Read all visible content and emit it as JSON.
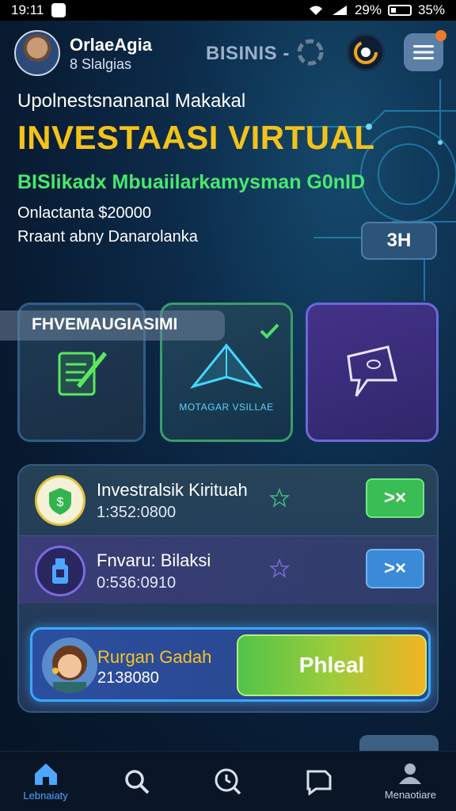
{
  "status_bar": {
    "time": "19:11",
    "battery_text": "29%",
    "battery_right": "35%"
  },
  "header": {
    "user_name": "OrlaeAgia",
    "user_sub": "8 Slalgias",
    "brand": "BISINIS -",
    "accent_color": "#f07a2a"
  },
  "hero": {
    "eyebrow": "Upolnestsnananal Makakal",
    "title": "INVESTAASI VIRTUAL",
    "subtitle": "BISlikadx Mbuaiilarkamysman G0nID",
    "line1": "Onlactanta $20000",
    "line2": "Rraant abny Danarolanka",
    "time_button": "3H"
  },
  "categories": {
    "label": "FHVEMAUGIASIMI",
    "cards": [
      {
        "icon": "document-pen-icon",
        "caption": ""
      },
      {
        "icon": "paper-plane-icon",
        "caption": "MOTAGAR VSILLAE"
      },
      {
        "icon": "map-flag-icon",
        "caption": ""
      }
    ]
  },
  "list": {
    "rows": [
      {
        "title": "Investralsik Kirituah",
        "value": "1:352:0800",
        "action": ">×",
        "icon": "money-shield-icon"
      },
      {
        "title": "Fnvaru: Bilaksi",
        "value": "0:536:0910",
        "action": ">×",
        "icon": "bottle-icon"
      },
      {
        "title": "Rurgan Gadah",
        "value": "2138080",
        "cta": "Phleal",
        "icon": "avatar-girl"
      }
    ]
  },
  "bottom_nav": [
    {
      "label": "Lebnaiaty",
      "icon": "home-icon",
      "active": true
    },
    {
      "label": "",
      "icon": "search-icon",
      "active": false
    },
    {
      "label": "",
      "icon": "clock-search-icon",
      "active": false
    },
    {
      "label": "",
      "icon": "chat-icon",
      "active": false
    },
    {
      "label": "Menaotiare",
      "icon": "profile-icon",
      "active": false
    }
  ]
}
